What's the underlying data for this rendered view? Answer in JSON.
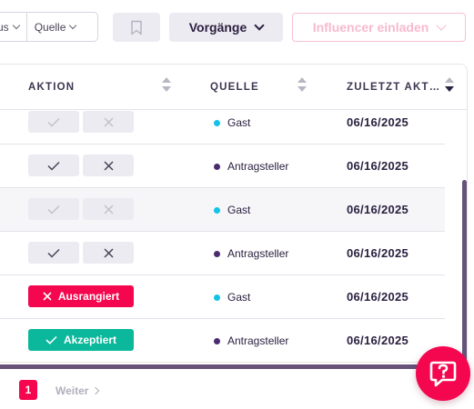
{
  "filters": {
    "status_label": "us",
    "source_label": "Quelle"
  },
  "toolbar": {
    "bookmark_icon": "bookmark-icon",
    "actions_label": "Vorgänge",
    "invite_label": "Influencer einladen"
  },
  "table": {
    "columns": {
      "action": "AKTION",
      "source": "QUELLE",
      "last_action": "ZULETZT AKT…"
    },
    "rows": [
      {
        "state": "pending-disabled",
        "source": "Gast",
        "date": "06/16/2025"
      },
      {
        "state": "pending",
        "source": "Antragsteller",
        "date": "06/16/2025"
      },
      {
        "state": "pending-disabled",
        "source": "Gast",
        "date": "06/16/2025"
      },
      {
        "state": "pending",
        "source": "Antragsteller",
        "date": "06/16/2025"
      },
      {
        "state": "rejected",
        "status_label": "Ausrangiert",
        "source": "Gast",
        "date": "06/16/2025"
      },
      {
        "state": "accepted",
        "status_label": "Akzeptiert",
        "source": "Antragsteller",
        "date": "06/16/2025"
      }
    ]
  },
  "pagination": {
    "current_page": "1",
    "next_label": "Weiter"
  },
  "colors": {
    "brand": "#f5074f",
    "accepted": "#0bb89b",
    "guest_dot": "#12c2e9",
    "applicant_dot": "#4a2d6e",
    "scroll": "#67537a"
  }
}
